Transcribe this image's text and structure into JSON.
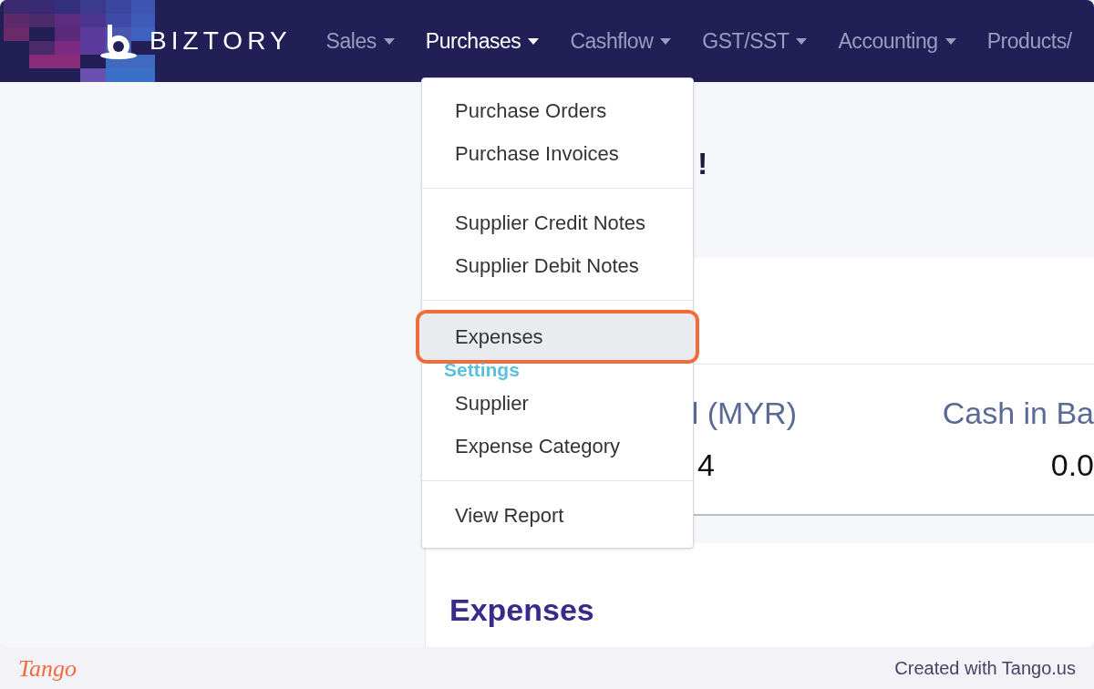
{
  "navbar": {
    "brand": "BIZTORY",
    "items": [
      {
        "label": "Sales",
        "selected": false,
        "caret": true
      },
      {
        "label": "Purchases",
        "selected": true,
        "caret": true
      },
      {
        "label": "Cashflow",
        "selected": false,
        "caret": true
      },
      {
        "label": "GST/SST",
        "selected": false,
        "caret": true
      },
      {
        "label": "Accounting",
        "selected": false,
        "caret": true
      },
      {
        "label": "Products/",
        "selected": false,
        "caret": false
      }
    ]
  },
  "dropdown": {
    "entries": [
      {
        "kind": "item",
        "label": "Purchase Orders",
        "highlighted": false
      },
      {
        "kind": "item",
        "label": "Purchase Invoices",
        "highlighted": false
      },
      {
        "kind": "divider"
      },
      {
        "kind": "item",
        "label": "Supplier Credit Notes",
        "highlighted": false
      },
      {
        "kind": "item",
        "label": "Supplier Debit Notes",
        "highlighted": false
      },
      {
        "kind": "divider"
      },
      {
        "kind": "item",
        "label": "Expenses",
        "highlighted": true
      },
      {
        "kind": "header",
        "label": "Settings"
      },
      {
        "kind": "item",
        "label": "Supplier",
        "highlighted": false
      },
      {
        "kind": "item",
        "label": "Expense Category",
        "highlighted": false
      },
      {
        "kind": "divider"
      },
      {
        "kind": "item",
        "label": "View Report",
        "highlighted": false
      }
    ]
  },
  "main": {
    "heading_fragment": "!",
    "stats": [
      {
        "label": "l (MYR)",
        "value": "4"
      },
      {
        "label": "Cash in Ba",
        "value": "0.0"
      }
    ],
    "expenses_card": {
      "title": "Expenses"
    }
  },
  "footer": {
    "brand": "Tango",
    "credit": "Created with Tango.us"
  }
}
